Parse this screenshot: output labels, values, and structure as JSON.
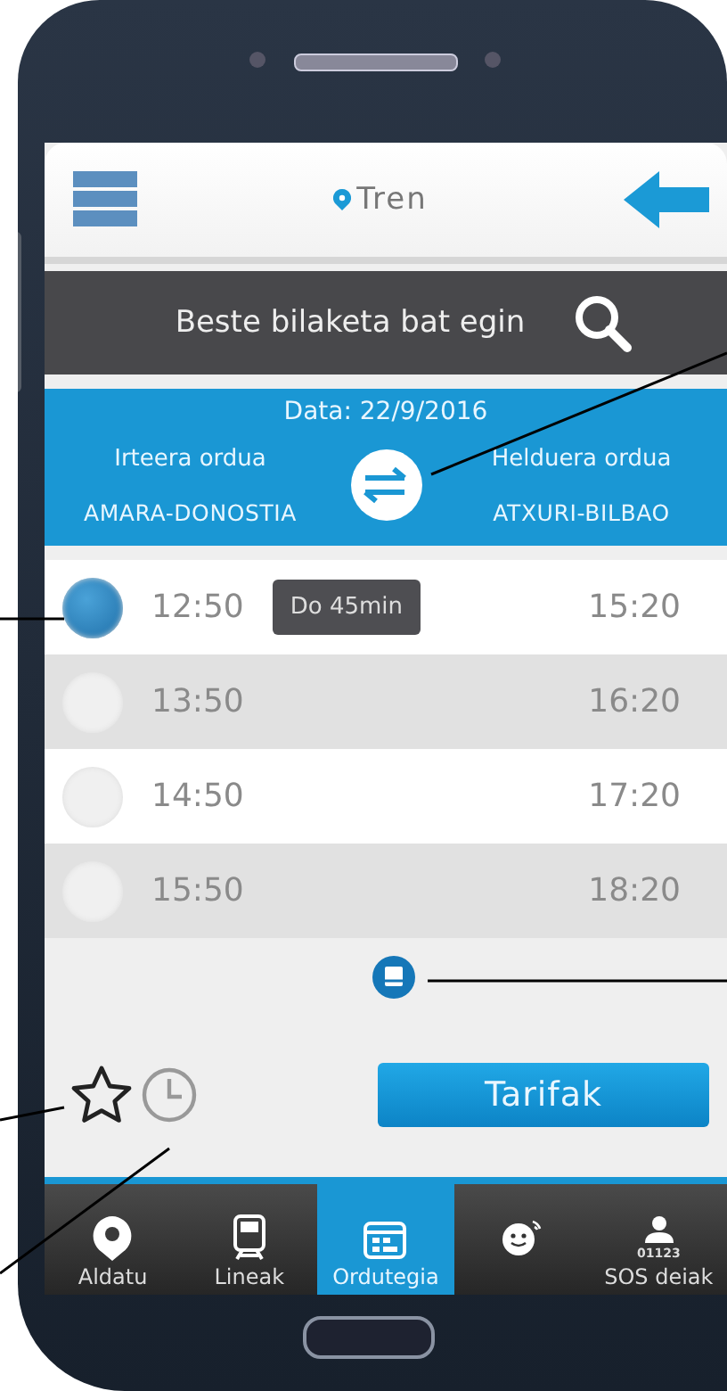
{
  "header": {
    "title": "Tren"
  },
  "search": {
    "label": "Beste bilaketa bat egin"
  },
  "route": {
    "date": "Data: 22/9/2016",
    "departure_label": "Irteera ordua",
    "arrival_label": "Helduera ordua",
    "origin": "AMARA-DONOSTIA",
    "destination": "ATXURI-BILBAO"
  },
  "trips": [
    {
      "departure": "12:50",
      "arrival": "15:20",
      "duration": "Do 45min",
      "selected": true
    },
    {
      "departure": "13:50",
      "arrival": "16:20",
      "selected": false
    },
    {
      "departure": "14:50",
      "arrival": "17:20",
      "selected": false
    },
    {
      "departure": "15:50",
      "arrival": "18:20",
      "selected": false
    }
  ],
  "fares_button": "Tarifak",
  "favorite": {
    "on": false
  },
  "nav": [
    {
      "kind": "pin",
      "label": "Aldatu",
      "selected": false
    },
    {
      "kind": "train",
      "label": "Lineak",
      "selected": false
    },
    {
      "kind": "calendar",
      "label": "Ordutegia",
      "selected": true
    },
    {
      "kind": "chat",
      "selected": false
    },
    {
      "kind": "sos",
      "label": "SOS deiak",
      "number": "01123",
      "selected": false
    }
  ]
}
